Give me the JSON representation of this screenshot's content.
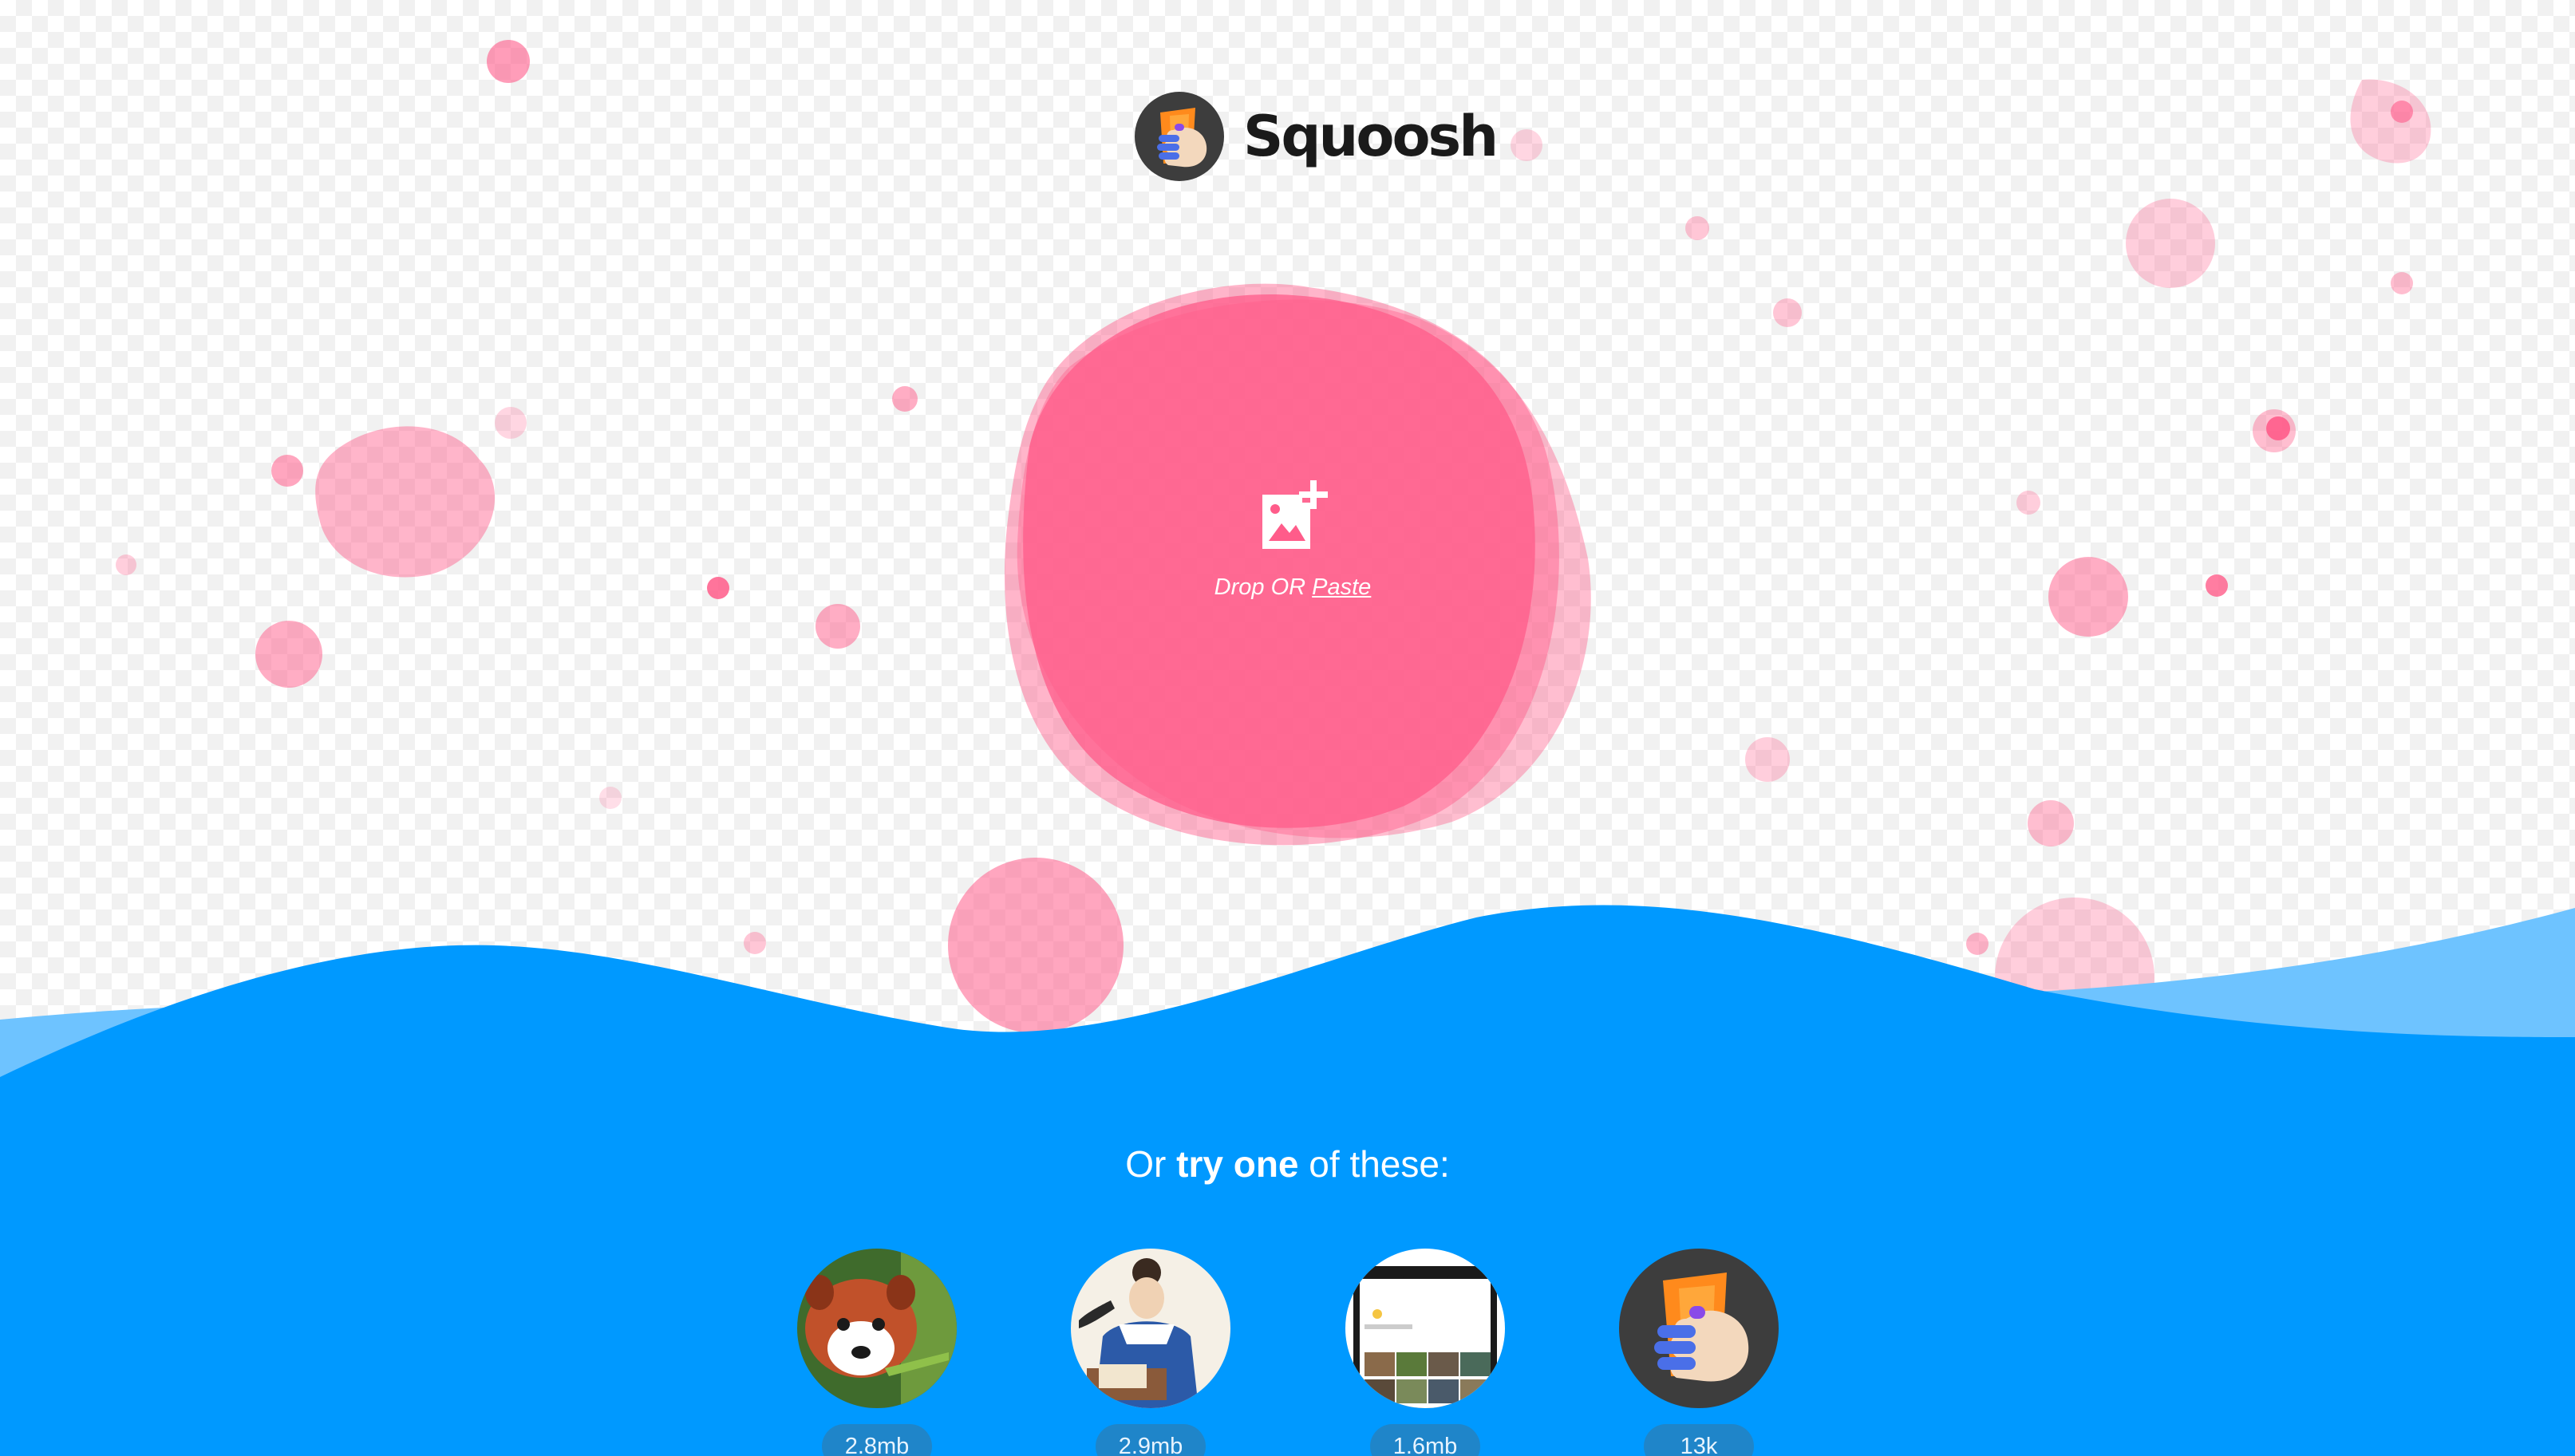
{
  "app": {
    "name": "Squoosh",
    "logo_icon": "squoosh-hand-logo-icon"
  },
  "dropzone": {
    "icon": "add-image-icon",
    "label_prefix": "Drop OR ",
    "paste_link": "Paste"
  },
  "demos": {
    "heading_prefix": "Or ",
    "heading_bold": "try one",
    "heading_suffix": " of these:",
    "items": [
      {
        "name": "red-panda",
        "size": "2.8mb"
      },
      {
        "name": "illustration-woman-writing",
        "size": "2.9mb"
      },
      {
        "name": "device-screenshot",
        "size": "1.6mb"
      },
      {
        "name": "squoosh-logo",
        "size": "13k"
      }
    ]
  },
  "colors": {
    "accent_pink": "#ff5c8a",
    "wave_blue": "#0099ff",
    "wave_light_blue": "#6ec3ff",
    "pill_blue": "#1f85c9"
  }
}
